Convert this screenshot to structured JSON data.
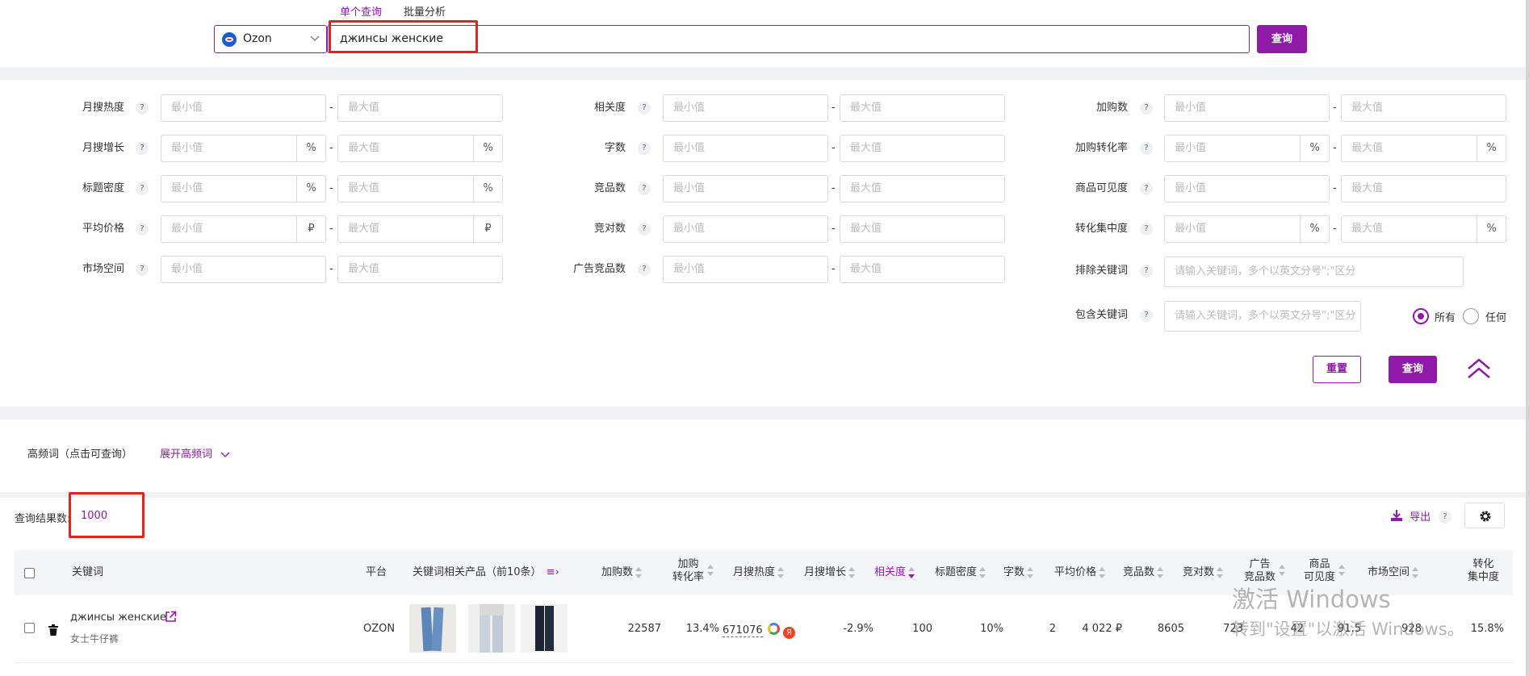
{
  "search": {
    "tab_single": "单个查询",
    "tab_batch": "批量分析",
    "platform": "Ozon",
    "keyword": "джинсы женские",
    "search_button": "查询"
  },
  "filters": {
    "min_placeholder": "最小值",
    "max_placeholder": "最大值",
    "help": "?",
    "dash": "-",
    "pct": "%",
    "rub": "₽",
    "col1": [
      "月搜热度",
      "月搜增长",
      "标题密度",
      "平均价格",
      "市场空间"
    ],
    "col2": [
      "相关度",
      "字数",
      "竞品数",
      "竞对数",
      "广告竞品数"
    ],
    "col3": [
      "加购数",
      "加购转化率",
      "商品可见度",
      "转化集中度"
    ],
    "exclude_label": "排除关键词",
    "include_label": "包含关键词",
    "keyword_placeholder": "请输入关键词，多个以英文分号\";\"区分",
    "radio_all": "所有",
    "radio_any": "任何",
    "reset_button": "重置",
    "query_button": "查询"
  },
  "hf": {
    "label": "高频词（点击可查询）",
    "expand": "展开高频词"
  },
  "results": {
    "count_label": "查询结果数:",
    "count": "1000",
    "export": "导出",
    "help": "?"
  },
  "table": {
    "headers": {
      "keyword": "关键词",
      "platform": "平台",
      "products": "关键词相关产品（前10条）",
      "cart": "加购数",
      "cart_conv_1": "加购",
      "cart_conv_2": "转化率",
      "monthly_heat": "月搜热度",
      "monthly_growth": "月搜增长",
      "relevance": "相关度",
      "title_density": "标题密度",
      "chars": "字数",
      "avg_price": "平均价格",
      "competitors": "竞品数",
      "rivals": "竞对数",
      "ad_1": "广告",
      "ad_2": "竞品数",
      "vis_1": "商品",
      "vis_2": "可见度",
      "market": "市场空间",
      "conc_1": "转化",
      "conc_2": "集中度"
    },
    "row": {
      "keyword": "джинсы женские",
      "translation": "女士牛仔裤",
      "platform": "OZON",
      "cart": "22587",
      "cart_conv": "13.4%",
      "monthly_heat": "671076",
      "monthly_growth": "-2.9%",
      "relevance": "100",
      "title_density": "10%",
      "chars": "2",
      "avg_price": "4 022 ₽",
      "competitors": "8605",
      "rivals": "723",
      "ad": "42",
      "vis": "91.5",
      "market": "928",
      "conc": "15.8%"
    }
  },
  "watermark": {
    "line1": "激活 Windows",
    "line2": "转到\"设置\"以激活 Windows。"
  },
  "colors": {
    "accent": "#8f1aa7",
    "highlight": "#e5231c"
  }
}
